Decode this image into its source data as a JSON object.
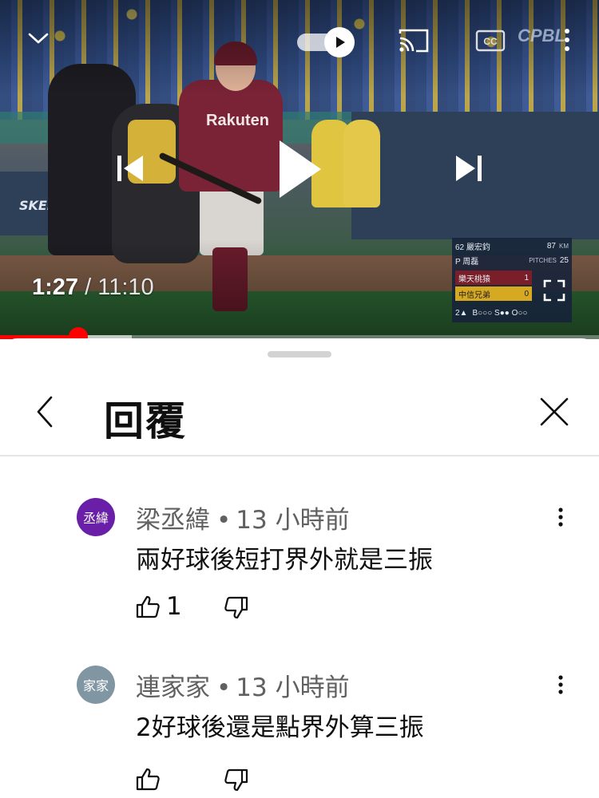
{
  "video": {
    "current_time": "1:27",
    "separator": " / ",
    "duration": "11:10",
    "progress_fraction": 0.13,
    "buffered_fraction": 0.22,
    "channel_logo": "CPBL",
    "jersey_text": "Rakuten",
    "banner_text": "SKEI",
    "icons": {
      "collapse": "chevron-down-icon",
      "autoplay": "autoplay-toggle-icon",
      "cast": "cast-icon",
      "captions": "closed-captions-icon",
      "more": "more-vert-icon",
      "previous": "skip-previous-icon",
      "play": "play-icon",
      "next": "skip-next-icon",
      "fullscreen": "fullscreen-icon"
    },
    "scoreboard": {
      "pitcher_line": "62 嚴宏鈞",
      "pitcher_speed": "87",
      "speed_unit": "KM",
      "batter_line": "P 周磊",
      "pitches_label": "PITCHES",
      "pitches": "25",
      "team1": "樂天桃猿",
      "team1_score": "1",
      "team2": "中信兄弟",
      "team2_score": "0",
      "inning": "2▲",
      "count": "B○○○ S●● O○○"
    }
  },
  "panel": {
    "title": "回覆",
    "icons": {
      "back": "chevron-left-icon",
      "close": "close-icon"
    }
  },
  "comments": [
    {
      "avatar_text": "丞緯",
      "avatar_color": "#6a1fa8",
      "author": "梁丞緯",
      "dot": "•",
      "time": "13 小時前",
      "text": "兩好球後短打界外就是三振",
      "likes": "1"
    },
    {
      "avatar_text": "家家",
      "avatar_color": "#8196a3",
      "author": "連家家",
      "dot": "•",
      "time": "13 小時前",
      "text": "2好球後還是點界外算三振",
      "likes": ""
    }
  ],
  "colors": {
    "progress": "#ff0000",
    "text_primary": "#0f0f0f",
    "text_secondary": "#606060"
  }
}
